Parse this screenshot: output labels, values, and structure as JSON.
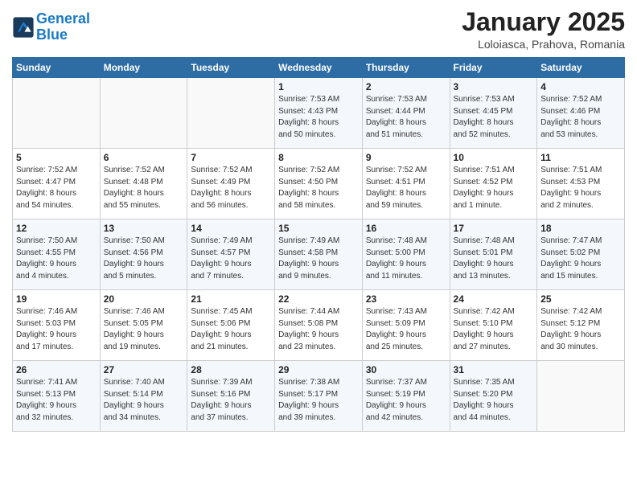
{
  "header": {
    "logo_line1": "General",
    "logo_line2": "Blue",
    "month": "January 2025",
    "location": "Loloiasca, Prahova, Romania"
  },
  "weekdays": [
    "Sunday",
    "Monday",
    "Tuesday",
    "Wednesday",
    "Thursday",
    "Friday",
    "Saturday"
  ],
  "weeks": [
    [
      {
        "day": "",
        "info": ""
      },
      {
        "day": "",
        "info": ""
      },
      {
        "day": "",
        "info": ""
      },
      {
        "day": "1",
        "info": "Sunrise: 7:53 AM\nSunset: 4:43 PM\nDaylight: 8 hours\nand 50 minutes."
      },
      {
        "day": "2",
        "info": "Sunrise: 7:53 AM\nSunset: 4:44 PM\nDaylight: 8 hours\nand 51 minutes."
      },
      {
        "day": "3",
        "info": "Sunrise: 7:53 AM\nSunset: 4:45 PM\nDaylight: 8 hours\nand 52 minutes."
      },
      {
        "day": "4",
        "info": "Sunrise: 7:52 AM\nSunset: 4:46 PM\nDaylight: 8 hours\nand 53 minutes."
      }
    ],
    [
      {
        "day": "5",
        "info": "Sunrise: 7:52 AM\nSunset: 4:47 PM\nDaylight: 8 hours\nand 54 minutes."
      },
      {
        "day": "6",
        "info": "Sunrise: 7:52 AM\nSunset: 4:48 PM\nDaylight: 8 hours\nand 55 minutes."
      },
      {
        "day": "7",
        "info": "Sunrise: 7:52 AM\nSunset: 4:49 PM\nDaylight: 8 hours\nand 56 minutes."
      },
      {
        "day": "8",
        "info": "Sunrise: 7:52 AM\nSunset: 4:50 PM\nDaylight: 8 hours\nand 58 minutes."
      },
      {
        "day": "9",
        "info": "Sunrise: 7:52 AM\nSunset: 4:51 PM\nDaylight: 8 hours\nand 59 minutes."
      },
      {
        "day": "10",
        "info": "Sunrise: 7:51 AM\nSunset: 4:52 PM\nDaylight: 9 hours\nand 1 minute."
      },
      {
        "day": "11",
        "info": "Sunrise: 7:51 AM\nSunset: 4:53 PM\nDaylight: 9 hours\nand 2 minutes."
      }
    ],
    [
      {
        "day": "12",
        "info": "Sunrise: 7:50 AM\nSunset: 4:55 PM\nDaylight: 9 hours\nand 4 minutes."
      },
      {
        "day": "13",
        "info": "Sunrise: 7:50 AM\nSunset: 4:56 PM\nDaylight: 9 hours\nand 5 minutes."
      },
      {
        "day": "14",
        "info": "Sunrise: 7:49 AM\nSunset: 4:57 PM\nDaylight: 9 hours\nand 7 minutes."
      },
      {
        "day": "15",
        "info": "Sunrise: 7:49 AM\nSunset: 4:58 PM\nDaylight: 9 hours\nand 9 minutes."
      },
      {
        "day": "16",
        "info": "Sunrise: 7:48 AM\nSunset: 5:00 PM\nDaylight: 9 hours\nand 11 minutes."
      },
      {
        "day": "17",
        "info": "Sunrise: 7:48 AM\nSunset: 5:01 PM\nDaylight: 9 hours\nand 13 minutes."
      },
      {
        "day": "18",
        "info": "Sunrise: 7:47 AM\nSunset: 5:02 PM\nDaylight: 9 hours\nand 15 minutes."
      }
    ],
    [
      {
        "day": "19",
        "info": "Sunrise: 7:46 AM\nSunset: 5:03 PM\nDaylight: 9 hours\nand 17 minutes."
      },
      {
        "day": "20",
        "info": "Sunrise: 7:46 AM\nSunset: 5:05 PM\nDaylight: 9 hours\nand 19 minutes."
      },
      {
        "day": "21",
        "info": "Sunrise: 7:45 AM\nSunset: 5:06 PM\nDaylight: 9 hours\nand 21 minutes."
      },
      {
        "day": "22",
        "info": "Sunrise: 7:44 AM\nSunset: 5:08 PM\nDaylight: 9 hours\nand 23 minutes."
      },
      {
        "day": "23",
        "info": "Sunrise: 7:43 AM\nSunset: 5:09 PM\nDaylight: 9 hours\nand 25 minutes."
      },
      {
        "day": "24",
        "info": "Sunrise: 7:42 AM\nSunset: 5:10 PM\nDaylight: 9 hours\nand 27 minutes."
      },
      {
        "day": "25",
        "info": "Sunrise: 7:42 AM\nSunset: 5:12 PM\nDaylight: 9 hours\nand 30 minutes."
      }
    ],
    [
      {
        "day": "26",
        "info": "Sunrise: 7:41 AM\nSunset: 5:13 PM\nDaylight: 9 hours\nand 32 minutes."
      },
      {
        "day": "27",
        "info": "Sunrise: 7:40 AM\nSunset: 5:14 PM\nDaylight: 9 hours\nand 34 minutes."
      },
      {
        "day": "28",
        "info": "Sunrise: 7:39 AM\nSunset: 5:16 PM\nDaylight: 9 hours\nand 37 minutes."
      },
      {
        "day": "29",
        "info": "Sunrise: 7:38 AM\nSunset: 5:17 PM\nDaylight: 9 hours\nand 39 minutes."
      },
      {
        "day": "30",
        "info": "Sunrise: 7:37 AM\nSunset: 5:19 PM\nDaylight: 9 hours\nand 42 minutes."
      },
      {
        "day": "31",
        "info": "Sunrise: 7:35 AM\nSunset: 5:20 PM\nDaylight: 9 hours\nand 44 minutes."
      },
      {
        "day": "",
        "info": ""
      }
    ]
  ]
}
